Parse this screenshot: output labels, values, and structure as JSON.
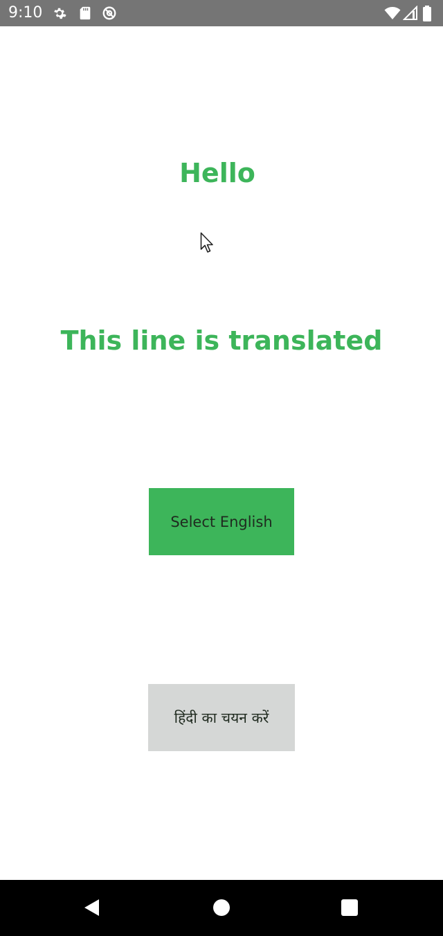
{
  "status_bar": {
    "time": "9:10",
    "left_icons": [
      "gear-icon",
      "sd-card-icon",
      "at-sign-icon"
    ],
    "right_icons": [
      "wifi-icon",
      "signal-icon",
      "battery-icon"
    ],
    "background_color": "#757575"
  },
  "main": {
    "greeting": "Hello",
    "translated_line": "This line is translated",
    "text_color": "#3db55a"
  },
  "buttons": {
    "english_label": "Select English",
    "hindi_label": "हिंदी का चयन करें",
    "english_color": "#3db55a",
    "hindi_color": "#d5d7d6"
  },
  "nav_bar": {
    "icons": [
      "back-icon",
      "home-icon",
      "recents-icon"
    ],
    "background_color": "#000000"
  }
}
